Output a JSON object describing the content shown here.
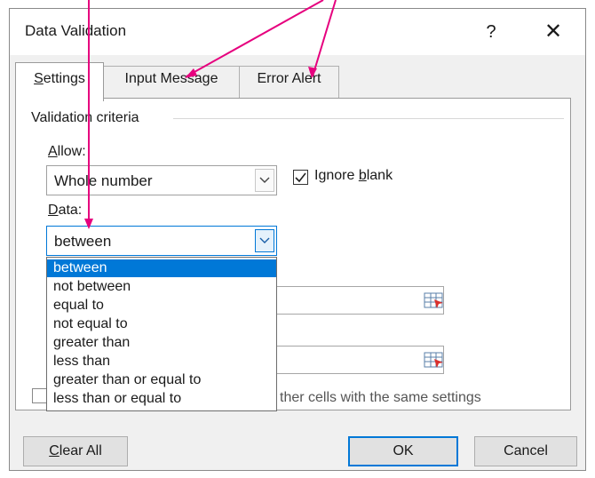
{
  "window": {
    "title": "Data Validation",
    "help": "?",
    "close": "✕"
  },
  "tabs": [
    {
      "label_underline": "S",
      "label_rest": "ettings",
      "active": true
    },
    {
      "label": "Input Message",
      "active": false
    },
    {
      "label": "Error Alert",
      "active": false
    }
  ],
  "criteria": {
    "group_label": "Validation criteria",
    "allow_label_u": "A",
    "allow_label_rest": "llow:",
    "allow_value": "Whole number",
    "ignore_blank_pre": "Ignore ",
    "ignore_blank_u": "b",
    "ignore_blank_post": "lank",
    "ignore_blank_checked": true,
    "data_label_u": "D",
    "data_label_rest": "ata:",
    "data_value": "between"
  },
  "dropdown": {
    "options": [
      "between",
      "not between",
      "equal to",
      "not equal to",
      "greater than",
      "less than",
      "greater than or equal to",
      "less than or equal to"
    ],
    "selected_index": 0
  },
  "apply_all_text": "ther cells with the same settings",
  "buttons": {
    "clear_u": "C",
    "clear_rest": "lear All",
    "ok": "OK",
    "cancel": "Cancel"
  },
  "icons": [
    "help-icon",
    "close-icon",
    "chevron-down-icon",
    "checkmark-icon",
    "range-select-icon"
  ],
  "colors": {
    "accent": "#0078d7",
    "annotation": "#e6007e"
  }
}
